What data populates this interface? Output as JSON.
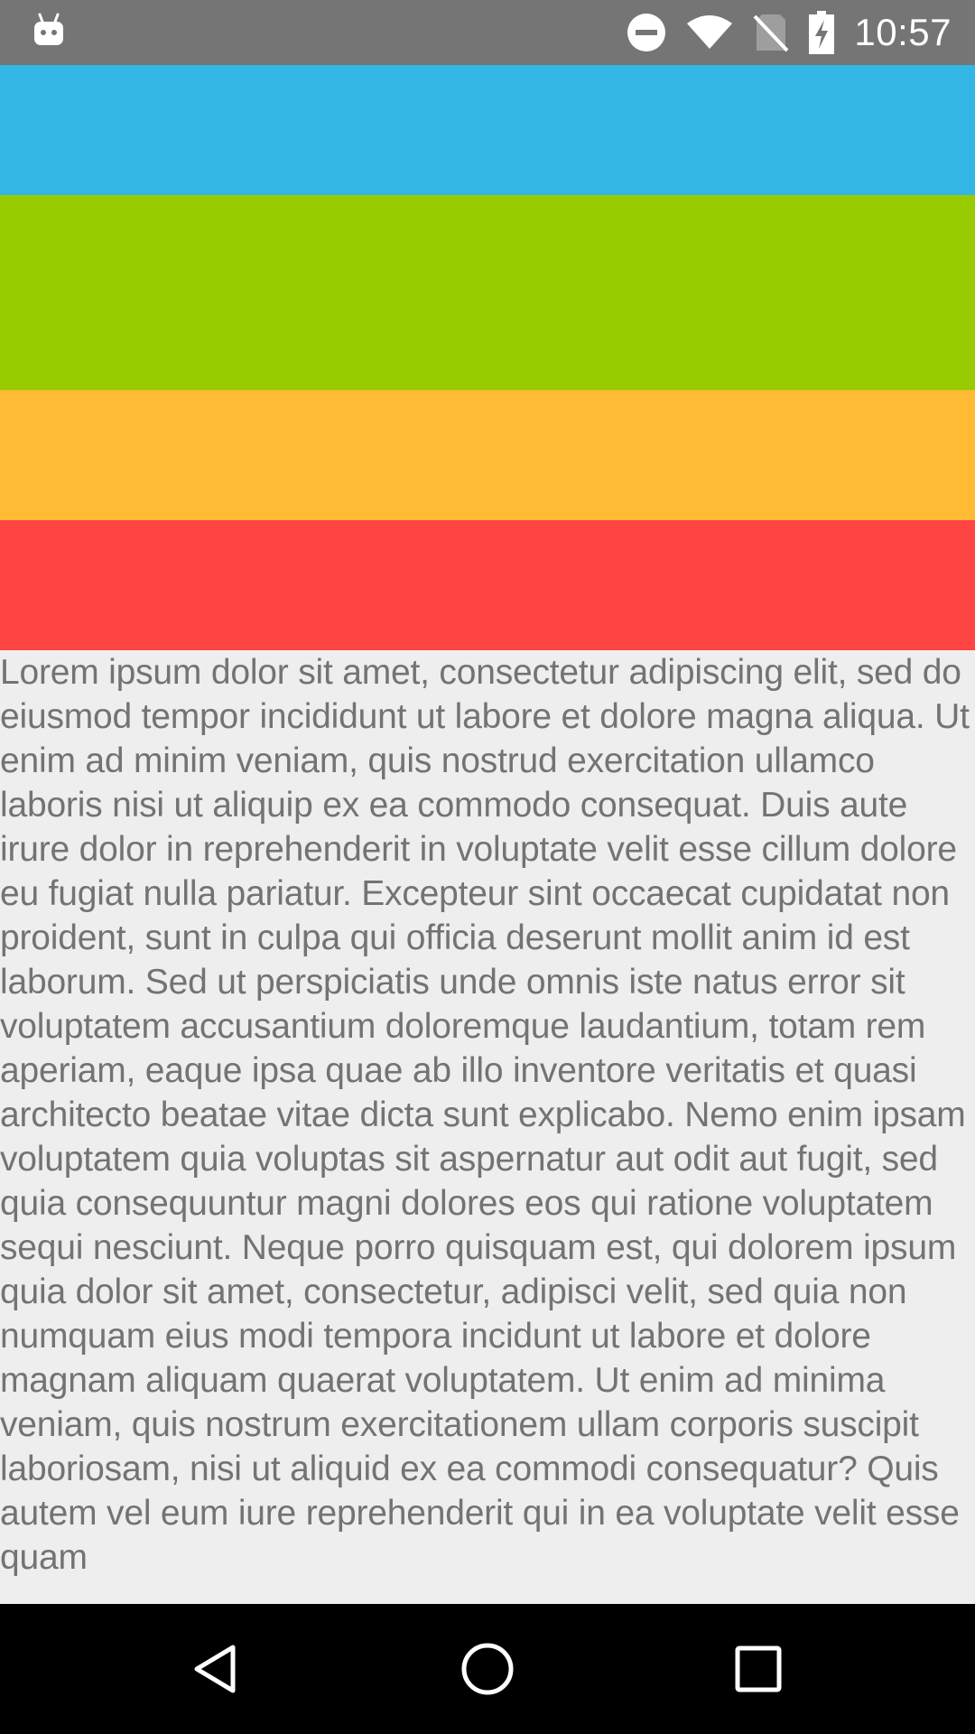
{
  "status_bar": {
    "time": "10:57",
    "icons": [
      "android-robot-icon",
      "do-not-disturb-icon",
      "wifi-icon",
      "no-sim-icon",
      "battery-charging-icon"
    ],
    "background": "#757575"
  },
  "bands": {
    "colors": [
      "#33b5e5",
      "#99cc00",
      "#ffbb33",
      "#ff4444"
    ]
  },
  "content": {
    "body_text": "Lorem ipsum dolor sit amet, consectetur adipiscing elit, sed do eiusmod tempor incididunt ut labore et dolore magna aliqua. Ut enim ad minim veniam, quis nostrud exercitation ullamco laboris nisi ut aliquip ex ea commodo consequat. Duis aute irure dolor in reprehenderit in voluptate velit esse cillum dolore eu fugiat nulla pariatur. Excepteur sint occaecat cupidatat non proident, sunt in culpa qui officia deserunt mollit anim id est laborum. Sed ut perspiciatis unde omnis iste natus error sit voluptatem accusantium doloremque laudantium, totam rem aperiam, eaque ipsa quae ab illo inventore veritatis et quasi architecto beatae vitae dicta sunt explicabo. Nemo enim ipsam voluptatem quia voluptas sit aspernatur aut odit aut fugit, sed quia consequuntur magni dolores eos qui ratione voluptatem sequi nesciunt. Neque porro quisquam est, qui dolorem ipsum quia dolor sit amet, consectetur, adipisci velit, sed quia non numquam eius modi tempora incidunt ut labore et dolore magnam aliquam quaerat voluptatem. Ut enim ad minima veniam, quis nostrum exercitationem ullam corporis suscipit laboriosam, nisi ut aliquid ex ea commodi consequatur? Quis autem vel eum iure reprehenderit qui in ea voluptate velit esse quam"
  },
  "nav_bar": {
    "buttons": [
      "back-icon",
      "home-icon",
      "recents-icon"
    ]
  }
}
